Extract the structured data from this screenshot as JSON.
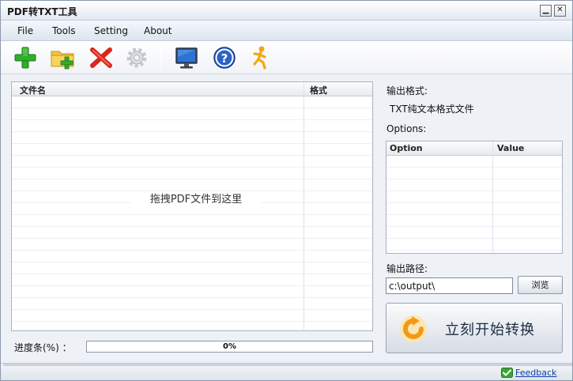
{
  "window": {
    "title": "PDF转TXT工具",
    "minimize_glyph": "▁",
    "close_glyph": "✕"
  },
  "menu": {
    "items": [
      "File",
      "Tools",
      "Setting",
      "About"
    ]
  },
  "toolbar": {
    "icons": [
      "add-file-icon",
      "add-folder-icon",
      "remove-icon",
      "settings-gear-icon",
      "monitor-icon",
      "help-icon",
      "run-person-icon"
    ]
  },
  "file_list": {
    "columns": [
      "文件名",
      "格式"
    ],
    "rows": [],
    "drop_hint": "拖拽PDF文件到这里"
  },
  "progress": {
    "label": "进度条(%) ：",
    "value": 0,
    "text": "0%"
  },
  "output_format": {
    "label": "输出格式:",
    "value": "TXT纯文本格式文件"
  },
  "options": {
    "label": "Options:",
    "columns": [
      "Option",
      "Value"
    ],
    "rows": []
  },
  "output_path": {
    "label": "输出路径:",
    "value": "c:\\output\\",
    "browse_label": "浏览"
  },
  "convert": {
    "label": "立刻开始转换"
  },
  "status": {
    "feedback_label": "Feedback"
  },
  "colors": {
    "accent": "#1b2c45",
    "progress_fill": "#8fc1ff",
    "link": "#0b3fa8"
  }
}
